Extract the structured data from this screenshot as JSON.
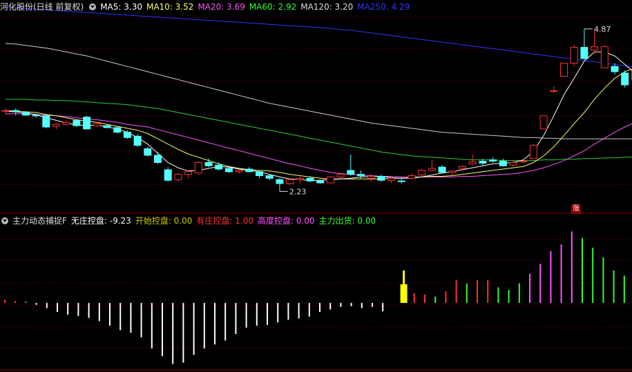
{
  "header": {
    "title": "河化股份(日线 前复权)",
    "ma": [
      {
        "label": "MA5: 3.30",
        "color": "#ffffff"
      },
      {
        "label": "MA10: 3.52",
        "color": "#ffff66"
      },
      {
        "label": "MA20: 3.69",
        "color": "#ff55ff"
      },
      {
        "label": "MA60: 2.92",
        "color": "#33ff33"
      },
      {
        "label": "MA120: 3.20",
        "color": "#dddddd"
      },
      {
        "label": "MA250: 4.29",
        "color": "#3333ff"
      }
    ]
  },
  "indicator": {
    "title": "主力动态捕捉F",
    "items": [
      {
        "label": "无庄控盘: -9.23",
        "color": "#ffffff"
      },
      {
        "label": "开始控盘: 0.00",
        "color": "#cccc00"
      },
      {
        "label": "有庄控盘: 1.00",
        "color": "#ff3333"
      },
      {
        "label": "高度控盘: 0.00",
        "color": "#ff55ff"
      },
      {
        "label": "主力出货: 0.00",
        "color": "#33ff33"
      }
    ]
  },
  "annotations": {
    "high": "4.87",
    "low": "2.23",
    "badge": "涨"
  },
  "colors": {
    "up": "#ff3333",
    "down": "#54ffff",
    "grid": "#8b0000",
    "ma5": "#ffffff",
    "ma10": "#ffff66",
    "ma20": "#ff55ff",
    "ma60": "#33cc33",
    "ma120": "#cccccc",
    "ma250": "#3333ff"
  },
  "chart_data": {
    "type": "candlestick",
    "price_range": [
      2.1,
      5.1
    ],
    "candles": [
      {
        "o": 3.62,
        "h": 3.66,
        "l": 3.58,
        "c": 3.63
      },
      {
        "o": 3.63,
        "h": 3.66,
        "l": 3.56,
        "c": 3.61
      },
      {
        "o": 3.6,
        "h": 3.62,
        "l": 3.55,
        "c": 3.56
      },
      {
        "o": 3.56,
        "h": 3.58,
        "l": 3.52,
        "c": 3.55
      },
      {
        "o": 3.55,
        "h": 3.58,
        "l": 3.36,
        "c": 3.38
      },
      {
        "o": 3.39,
        "h": 3.44,
        "l": 3.35,
        "c": 3.42
      },
      {
        "o": 3.42,
        "h": 3.48,
        "l": 3.4,
        "c": 3.45
      },
      {
        "o": 3.48,
        "h": 3.5,
        "l": 3.38,
        "c": 3.4
      },
      {
        "o": 3.53,
        "h": 3.55,
        "l": 3.34,
        "c": 3.35
      },
      {
        "o": 3.4,
        "h": 3.45,
        "l": 3.38,
        "c": 3.43
      },
      {
        "o": 3.4,
        "h": 3.42,
        "l": 3.36,
        "c": 3.37
      },
      {
        "o": 3.37,
        "h": 3.4,
        "l": 3.28,
        "c": 3.3
      },
      {
        "o": 3.3,
        "h": 3.33,
        "l": 3.2,
        "c": 3.22
      },
      {
        "o": 3.24,
        "h": 3.27,
        "l": 3.08,
        "c": 3.1
      },
      {
        "o": 3.05,
        "h": 3.08,
        "l": 2.93,
        "c": 2.95
      },
      {
        "o": 2.95,
        "h": 3.0,
        "l": 2.82,
        "c": 2.84
      },
      {
        "o": 2.73,
        "h": 2.77,
        "l": 2.55,
        "c": 2.57
      },
      {
        "o": 2.58,
        "h": 2.68,
        "l": 2.56,
        "c": 2.66
      },
      {
        "o": 2.66,
        "h": 2.72,
        "l": 2.6,
        "c": 2.7
      },
      {
        "o": 2.68,
        "h": 2.86,
        "l": 2.66,
        "c": 2.84
      },
      {
        "o": 2.84,
        "h": 2.9,
        "l": 2.77,
        "c": 2.79
      },
      {
        "o": 2.8,
        "h": 2.84,
        "l": 2.72,
        "c": 2.74
      },
      {
        "o": 2.75,
        "h": 2.78,
        "l": 2.68,
        "c": 2.7
      },
      {
        "o": 2.7,
        "h": 2.74,
        "l": 2.67,
        "c": 2.72
      },
      {
        "o": 2.74,
        "h": 2.77,
        "l": 2.69,
        "c": 2.7
      },
      {
        "o": 2.7,
        "h": 2.72,
        "l": 2.6,
        "c": 2.64
      },
      {
        "o": 2.64,
        "h": 2.66,
        "l": 2.57,
        "c": 2.6
      },
      {
        "o": 2.58,
        "h": 2.6,
        "l": 2.4,
        "c": 2.52
      },
      {
        "o": 2.52,
        "h": 2.6,
        "l": 2.5,
        "c": 2.58
      },
      {
        "o": 2.58,
        "h": 2.63,
        "l": 2.52,
        "c": 2.6
      },
      {
        "o": 2.6,
        "h": 2.63,
        "l": 2.54,
        "c": 2.56
      },
      {
        "o": 2.56,
        "h": 2.58,
        "l": 2.52,
        "c": 2.53
      },
      {
        "o": 2.53,
        "h": 2.64,
        "l": 2.53,
        "c": 2.62
      },
      {
        "o": 2.62,
        "h": 2.68,
        "l": 2.6,
        "c": 2.66
      },
      {
        "o": 2.72,
        "h": 2.96,
        "l": 2.64,
        "c": 2.66
      },
      {
        "o": 2.66,
        "h": 2.72,
        "l": 2.6,
        "c": 2.64
      },
      {
        "o": 2.6,
        "h": 2.66,
        "l": 2.55,
        "c": 2.63
      },
      {
        "o": 2.63,
        "h": 2.66,
        "l": 2.55,
        "c": 2.57
      },
      {
        "o": 2.57,
        "h": 2.62,
        "l": 2.53,
        "c": 2.6
      },
      {
        "o": 2.56,
        "h": 2.62,
        "l": 2.52,
        "c": 2.55
      },
      {
        "o": 2.6,
        "h": 2.68,
        "l": 2.58,
        "c": 2.64
      },
      {
        "o": 2.65,
        "h": 2.74,
        "l": 2.63,
        "c": 2.72
      },
      {
        "o": 2.72,
        "h": 2.88,
        "l": 2.7,
        "c": 2.75
      },
      {
        "o": 2.77,
        "h": 2.8,
        "l": 2.68,
        "c": 2.69
      },
      {
        "o": 2.69,
        "h": 2.72,
        "l": 2.64,
        "c": 2.71
      },
      {
        "o": 2.75,
        "h": 2.8,
        "l": 2.72,
        "c": 2.78
      },
      {
        "o": 2.82,
        "h": 2.96,
        "l": 2.8,
        "c": 2.85
      },
      {
        "o": 2.86,
        "h": 2.9,
        "l": 2.8,
        "c": 2.83
      },
      {
        "o": 2.88,
        "h": 2.92,
        "l": 2.84,
        "c": 2.86
      },
      {
        "o": 2.86,
        "h": 2.9,
        "l": 2.78,
        "c": 2.79
      },
      {
        "o": 2.8,
        "h": 2.88,
        "l": 2.78,
        "c": 2.84
      },
      {
        "o": 2.85,
        "h": 2.88,
        "l": 2.83,
        "c": 2.86
      },
      {
        "o": 2.9,
        "h": 3.12,
        "l": 2.9,
        "c": 3.1
      },
      {
        "o": 3.35,
        "h": 3.55,
        "l": 3.35,
        "c": 3.55
      },
      {
        "o": 3.93,
        "h": 4.0,
        "l": 3.9,
        "c": 3.93
      },
      {
        "o": 4.15,
        "h": 4.35,
        "l": 4.15,
        "c": 4.35
      },
      {
        "o": 4.35,
        "h": 4.63,
        "l": 4.3,
        "c": 4.59
      },
      {
        "o": 4.59,
        "h": 4.87,
        "l": 4.4,
        "c": 4.42
      },
      {
        "o": 4.55,
        "h": 4.86,
        "l": 4.5,
        "c": 4.6
      },
      {
        "o": 4.28,
        "h": 4.62,
        "l": 4.28,
        "c": 4.6
      },
      {
        "o": 4.3,
        "h": 4.35,
        "l": 4.18,
        "c": 4.22
      },
      {
        "o": 4.2,
        "h": 4.24,
        "l": 3.98,
        "c": 4.02
      },
      {
        "o": 4.1,
        "h": 4.25,
        "l": 4.08,
        "c": 4.23
      }
    ],
    "ma5": [
      3.62,
      3.61,
      3.59,
      3.57,
      3.52,
      3.48,
      3.44,
      3.41,
      3.4,
      3.41,
      3.38,
      3.35,
      3.3,
      3.22,
      3.12,
      2.98,
      2.84,
      2.76,
      2.71,
      2.72,
      2.75,
      2.78,
      2.77,
      2.74,
      2.72,
      2.7,
      2.66,
      2.62,
      2.59,
      2.58,
      2.57,
      2.57,
      2.58,
      2.59,
      2.6,
      2.62,
      2.63,
      2.63,
      2.61,
      2.6,
      2.6,
      2.62,
      2.65,
      2.68,
      2.7,
      2.73,
      2.76,
      2.79,
      2.82,
      2.83,
      2.84,
      2.88,
      3.01,
      3.25,
      3.55,
      3.87,
      4.12,
      4.38,
      4.52,
      4.52,
      4.46,
      4.33,
      4.2
    ],
    "ma10": [
      3.63,
      3.62,
      3.61,
      3.6,
      3.57,
      3.55,
      3.52,
      3.49,
      3.47,
      3.45,
      3.42,
      3.39,
      3.36,
      3.33,
      3.28,
      3.2,
      3.12,
      3.04,
      2.97,
      2.92,
      2.87,
      2.82,
      2.78,
      2.75,
      2.73,
      2.72,
      2.71,
      2.69,
      2.66,
      2.64,
      2.62,
      2.6,
      2.59,
      2.59,
      2.59,
      2.59,
      2.59,
      2.59,
      2.6,
      2.6,
      2.61,
      2.62,
      2.63,
      2.63,
      2.64,
      2.66,
      2.68,
      2.7,
      2.72,
      2.74,
      2.76,
      2.78,
      2.84,
      2.94,
      3.08,
      3.25,
      3.43,
      3.6,
      3.8,
      3.97,
      4.12,
      4.22,
      4.28
    ],
    "ma20": [
      3.58,
      3.58,
      3.58,
      3.57,
      3.56,
      3.55,
      3.54,
      3.52,
      3.5,
      3.49,
      3.47,
      3.45,
      3.42,
      3.4,
      3.38,
      3.34,
      3.3,
      3.26,
      3.22,
      3.18,
      3.14,
      3.1,
      3.06,
      3.02,
      2.98,
      2.94,
      2.9,
      2.86,
      2.82,
      2.79,
      2.75,
      2.72,
      2.69,
      2.67,
      2.66,
      2.65,
      2.64,
      2.63,
      2.63,
      2.62,
      2.62,
      2.62,
      2.62,
      2.62,
      2.62,
      2.63,
      2.63,
      2.64,
      2.65,
      2.66,
      2.67,
      2.69,
      2.72,
      2.76,
      2.81,
      2.87,
      2.94,
      3.02,
      3.12,
      3.21,
      3.3,
      3.38,
      3.45
    ],
    "ma60": [
      3.8,
      3.8,
      3.8,
      3.79,
      3.79,
      3.78,
      3.78,
      3.77,
      3.76,
      3.75,
      3.74,
      3.73,
      3.72,
      3.7,
      3.68,
      3.66,
      3.63,
      3.6,
      3.57,
      3.54,
      3.51,
      3.48,
      3.45,
      3.42,
      3.39,
      3.36,
      3.33,
      3.3,
      3.27,
      3.24,
      3.21,
      3.18,
      3.15,
      3.12,
      3.09,
      3.06,
      3.03,
      3.0,
      2.98,
      2.96,
      2.94,
      2.93,
      2.92,
      2.91,
      2.9,
      2.89,
      2.88,
      2.88,
      2.88,
      2.87,
      2.87,
      2.87,
      2.87,
      2.88,
      2.88,
      2.89,
      2.89,
      2.9,
      2.9,
      2.91,
      2.91,
      2.92,
      2.92
    ],
    "ma120": [
      4.65,
      4.64,
      4.62,
      4.6,
      4.58,
      4.55,
      4.52,
      4.49,
      4.46,
      4.42,
      4.38,
      4.34,
      4.3,
      4.26,
      4.22,
      4.18,
      4.14,
      4.1,
      4.06,
      4.02,
      3.98,
      3.94,
      3.9,
      3.86,
      3.82,
      3.78,
      3.74,
      3.71,
      3.68,
      3.65,
      3.62,
      3.59,
      3.56,
      3.53,
      3.5,
      3.47,
      3.44,
      3.42,
      3.4,
      3.38,
      3.36,
      3.34,
      3.32,
      3.3,
      3.29,
      3.28,
      3.27,
      3.26,
      3.25,
      3.24,
      3.23,
      3.22,
      3.22,
      3.21,
      3.21,
      3.2,
      3.2,
      3.2,
      3.2,
      3.2,
      3.2,
      3.2,
      3.2
    ],
    "ma250": [
      5.2,
      5.19,
      5.18,
      5.17,
      5.16,
      5.15,
      5.14,
      5.13,
      5.12,
      5.11,
      5.1,
      5.09,
      5.08,
      5.07,
      5.06,
      5.05,
      5.04,
      5.03,
      5.02,
      5.01,
      5.0,
      4.99,
      4.98,
      4.97,
      4.96,
      4.95,
      4.94,
      4.93,
      4.92,
      4.91,
      4.9,
      4.89,
      4.88,
      4.86,
      4.85,
      4.83,
      4.81,
      4.79,
      4.77,
      4.75,
      4.73,
      4.71,
      4.69,
      4.67,
      4.65,
      4.63,
      4.61,
      4.59,
      4.57,
      4.55,
      4.53,
      4.51,
      4.49,
      4.47,
      4.45,
      4.43,
      4.41,
      4.39,
      4.37,
      4.35,
      4.33,
      4.31,
      4.29
    ],
    "indicator_range": [
      -10,
      12
    ],
    "indicator_bars": [
      {
        "v": 0.5,
        "t": "red"
      },
      {
        "v": 0.3,
        "t": "red"
      },
      {
        "v": 0.2,
        "t": "green"
      },
      {
        "v": -0.3,
        "t": "white"
      },
      {
        "v": -0.8,
        "t": "white"
      },
      {
        "v": -1.4,
        "t": "white"
      },
      {
        "v": -1.8,
        "t": "white"
      },
      {
        "v": -2.0,
        "t": "white"
      },
      {
        "v": -2.3,
        "t": "white"
      },
      {
        "v": -2.8,
        "t": "white"
      },
      {
        "v": -3.5,
        "t": "white"
      },
      {
        "v": -4.2,
        "t": "white"
      },
      {
        "v": -4.6,
        "t": "white"
      },
      {
        "v": -5.3,
        "t": "white"
      },
      {
        "v": -7.0,
        "t": "white"
      },
      {
        "v": -8.2,
        "t": "white"
      },
      {
        "v": -9.4,
        "t": "white"
      },
      {
        "v": -9.2,
        "t": "white"
      },
      {
        "v": -8.0,
        "t": "white"
      },
      {
        "v": -7.0,
        "t": "white"
      },
      {
        "v": -6.4,
        "t": "white"
      },
      {
        "v": -5.8,
        "t": "white"
      },
      {
        "v": -4.8,
        "t": "white"
      },
      {
        "v": -3.8,
        "t": "white"
      },
      {
        "v": -3.5,
        "t": "white"
      },
      {
        "v": -3.4,
        "t": "white"
      },
      {
        "v": -3.0,
        "t": "white"
      },
      {
        "v": -2.6,
        "t": "white"
      },
      {
        "v": -2.4,
        "t": "white"
      },
      {
        "v": -2.1,
        "t": "white"
      },
      {
        "v": -1.4,
        "t": "white"
      },
      {
        "v": -1.0,
        "t": "white"
      },
      {
        "v": -0.6,
        "t": "white"
      },
      {
        "v": -0.5,
        "t": "white"
      },
      {
        "v": -0.8,
        "t": "white"
      },
      {
        "v": -0.6,
        "t": "white"
      },
      {
        "v": -1.3,
        "t": "white"
      },
      {
        "v": 0,
        "t": "none"
      },
      {
        "v": 5.0,
        "t": "yellow"
      },
      {
        "v": 1.5,
        "t": "red"
      },
      {
        "v": 1.3,
        "t": "red"
      },
      {
        "v": 1.0,
        "t": "green"
      },
      {
        "v": 1.8,
        "t": "red"
      },
      {
        "v": 3.5,
        "t": "red"
      },
      {
        "v": 3.0,
        "t": "green"
      },
      {
        "v": 3.5,
        "t": "red"
      },
      {
        "v": 3.5,
        "t": "red"
      },
      {
        "v": 2.4,
        "t": "green"
      },
      {
        "v": 2.0,
        "t": "green"
      },
      {
        "v": 3.0,
        "t": "green"
      },
      {
        "v": 4.5,
        "t": "magenta"
      },
      {
        "v": 6.0,
        "t": "magenta"
      },
      {
        "v": 8.0,
        "t": "magenta"
      },
      {
        "v": 9.0,
        "t": "magenta"
      },
      {
        "v": 11.0,
        "t": "magenta"
      },
      {
        "v": 10.0,
        "t": "green"
      },
      {
        "v": 8.5,
        "t": "green"
      },
      {
        "v": 7.0,
        "t": "green"
      },
      {
        "v": 5.0,
        "t": "green"
      },
      {
        "v": 4.2,
        "t": "green"
      }
    ]
  }
}
